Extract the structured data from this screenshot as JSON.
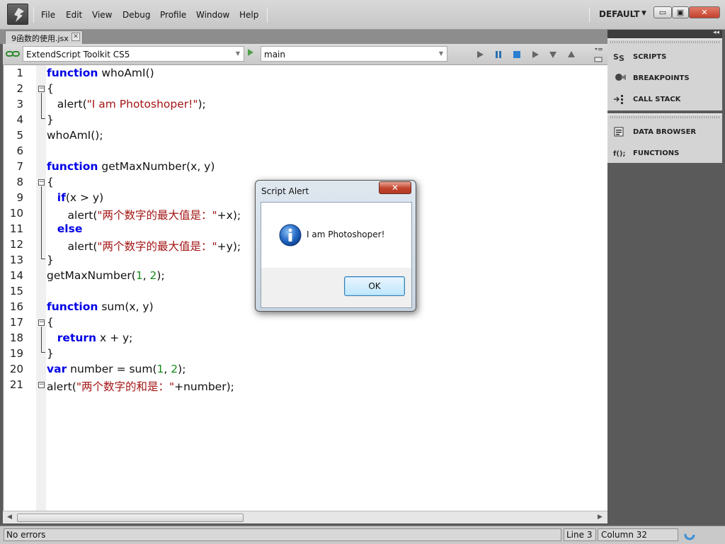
{
  "menubar": {
    "items": [
      "File",
      "Edit",
      "View",
      "Debug",
      "Profile",
      "Window",
      "Help"
    ],
    "workspace": "DEFAULT"
  },
  "tab": {
    "filename": "9函数的使用.jsx"
  },
  "toolbar": {
    "target_app": "ExtendScript Toolkit CS5",
    "engine": "main"
  },
  "editor": {
    "line_numbers": [
      "1",
      "2",
      "3",
      "4",
      "5",
      "6",
      "7",
      "8",
      "9",
      "10",
      "11",
      "12",
      "13",
      "14",
      "15",
      "16",
      "17",
      "18",
      "19",
      "20",
      "21"
    ]
  },
  "panels": {
    "group1": [
      {
        "icon": "scripts-icon",
        "label": "SCRIPTS"
      },
      {
        "icon": "breakpoints-icon",
        "label": "BREAKPOINTS"
      },
      {
        "icon": "call-stack-icon",
        "label": "CALL STACK"
      }
    ],
    "group2": [
      {
        "icon": "data-browser-icon",
        "label": "DATA BROWSER"
      },
      {
        "icon": "functions-icon",
        "label": "FUNCTIONS"
      }
    ]
  },
  "status": {
    "message": "No errors",
    "line": "Line 3",
    "column": "Column 32"
  },
  "dialog": {
    "title": "Script Alert",
    "message": "I am Photoshoper!",
    "ok_label": "OK"
  }
}
